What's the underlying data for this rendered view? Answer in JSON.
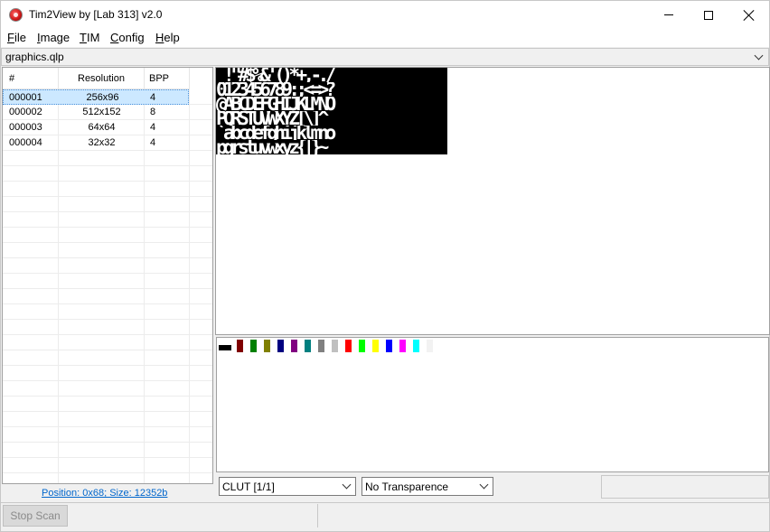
{
  "window": {
    "title": "Tim2View by [Lab 313] v2.0"
  },
  "menu": [
    {
      "u": "F",
      "rest": "ile"
    },
    {
      "u": "I",
      "rest": "mage"
    },
    {
      "u": "T",
      "rest": "IM"
    },
    {
      "u": "C",
      "rest": "onfig"
    },
    {
      "u": "H",
      "rest": "elp"
    }
  ],
  "file": {
    "name": "graphics.qlp"
  },
  "list": {
    "headers": [
      "#",
      "Resolution",
      "BPP"
    ],
    "rows": [
      {
        "id": "000001",
        "res": "256x96",
        "bpp": "4",
        "selected": true
      },
      {
        "id": "000002",
        "res": "512x152",
        "bpp": "8",
        "selected": false
      },
      {
        "id": "000003",
        "res": "64x64",
        "bpp": "4",
        "selected": false
      },
      {
        "id": "000004",
        "res": "32x32",
        "bpp": "4",
        "selected": false
      }
    ]
  },
  "status": {
    "position_size": "Position: 0x68;  Size: 12352b"
  },
  "image": {
    "glyph_rows": [
      " !\"#$%&'()*+,-./",
      "0123456789:;<=>?",
      "@ABCDEFGHIJKLMNO",
      "PQRSTUVWXYZ[\\]^_",
      "`abcdefghijklmno",
      "pqrstuvwxyz{|}~ "
    ]
  },
  "clut": {
    "colors": [
      "#000000",
      "#800000",
      "#008000",
      "#808000",
      "#000080",
      "#800080",
      "#008080",
      "#808080",
      "#c0c0c0",
      "#ff0000",
      "#00ff00",
      "#ffff00",
      "#0000ff",
      "#ff00ff",
      "#00ffff",
      "#ffffff"
    ]
  },
  "controls": {
    "clut_select": "CLUT [1/1]",
    "transparency_select": "No Transparence",
    "stop_scan": "Stop Scan"
  }
}
